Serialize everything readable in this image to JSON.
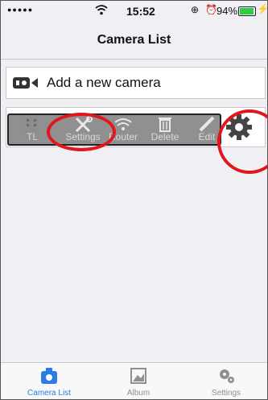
{
  "status_bar": {
    "signal": "●●●●●",
    "time": "15:52",
    "battery_percent": "94%",
    "battery_level": 0.94
  },
  "nav": {
    "title": "Camera List"
  },
  "add_camera": {
    "label": "Add a new camera",
    "icon": "camera-icon"
  },
  "camera_actions": [
    {
      "label": "TL",
      "icon": "film-icon"
    },
    {
      "label": "Settings",
      "icon": "wrench-icon"
    },
    {
      "label": "Router",
      "icon": "wifi-icon"
    },
    {
      "label": "Delete",
      "icon": "trash-icon"
    },
    {
      "label": "Edit",
      "icon": "pencil-icon"
    }
  ],
  "tabs": [
    {
      "label": "Camera List",
      "icon": "camera-list-icon",
      "active": true
    },
    {
      "label": "Album",
      "icon": "album-icon",
      "active": false
    },
    {
      "label": "Settings",
      "icon": "gear-icon",
      "active": false
    }
  ],
  "colors": {
    "accent": "#2b7ce5",
    "highlight_circle": "#e0161c",
    "battery": "#2ecc40"
  }
}
